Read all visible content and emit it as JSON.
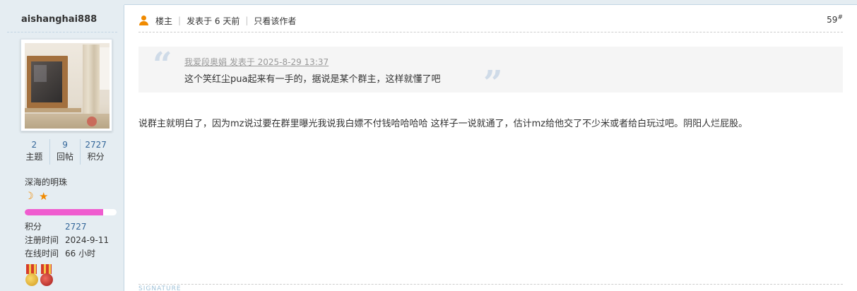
{
  "author": {
    "name": "aishanghai888",
    "stats": [
      {
        "num": "2",
        "label": "主题"
      },
      {
        "num": "9",
        "label": "回帖"
      },
      {
        "num": "2727",
        "label": "积分"
      }
    ],
    "group": "深海的明珠",
    "rank_icons": [
      "moon-icon",
      "star-icon"
    ],
    "progress_fraction": 0.85,
    "progress_color": "#ef5ccf",
    "info": [
      {
        "key": "积分",
        "value": "2727"
      },
      {
        "key": "注册时间",
        "value": "2024-9-11"
      },
      {
        "key": "在线时间",
        "value": "66 小时"
      }
    ],
    "medals": [
      "medal-icon",
      "medal-icon"
    ]
  },
  "post": {
    "owner_label": "楼主",
    "posted_label": "发表于 6 天前",
    "only_author_label": "只看该作者",
    "floor_number": "59",
    "floor_mark": "#",
    "quote": {
      "source": "我爱段奥娟 发表于 2025-8-29 13:37",
      "text": "这个笑红尘pua起来有一手的，据说是某个群主，这样就懂了吧"
    },
    "body": "说群主就明白了，因为mz说过要在群里曝光我说我白嫖不付钱哈哈哈哈 这样子一说就通了，估计mz给他交了不少米或者给白玩过吧。阴阳人烂屁股。",
    "signature_label": "SIGNATURE"
  },
  "colors": {
    "sidebar_bg": "#e5edf2",
    "border": "#c2d5e3",
    "link": "#336699",
    "accent_orange": "#f08a00",
    "quote_bg": "#f5f5f5"
  }
}
